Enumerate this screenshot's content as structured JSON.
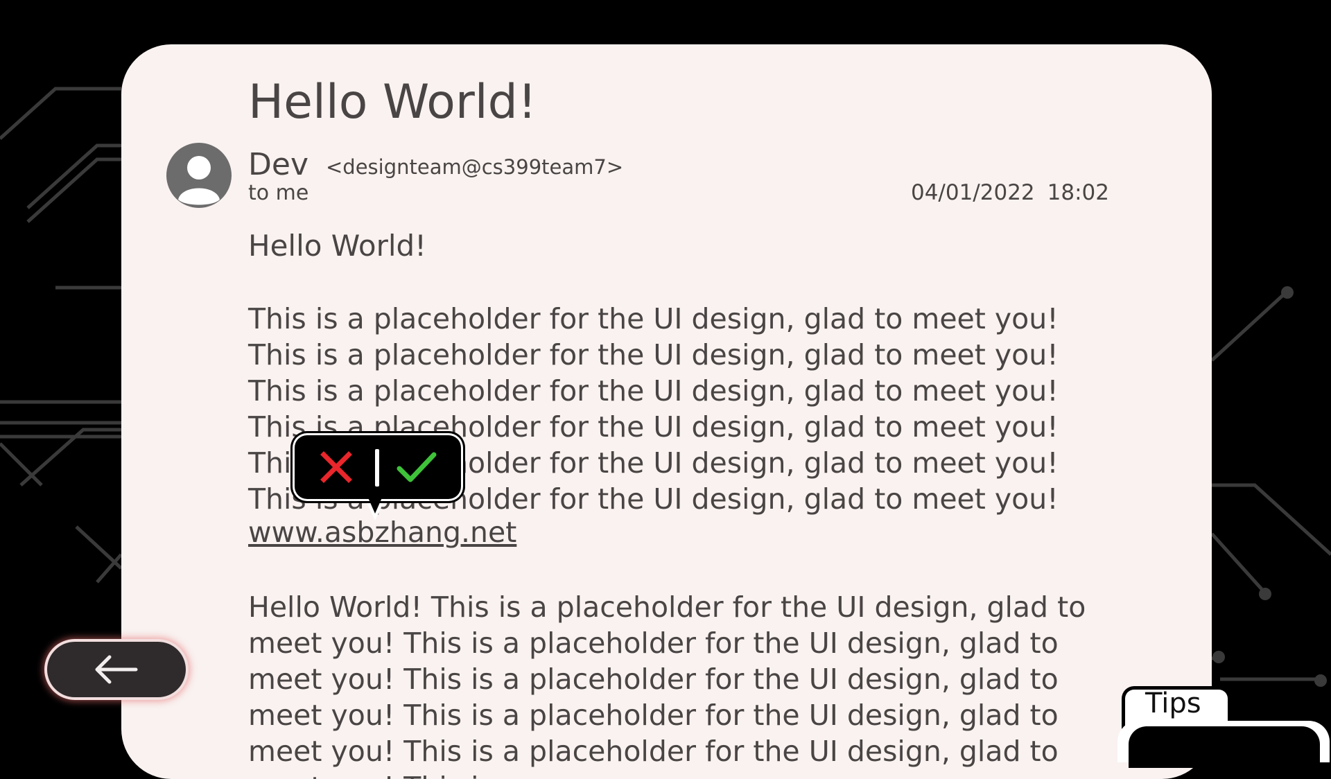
{
  "email": {
    "subject": "Hello World!",
    "sender_name": "Dev",
    "sender_email": "<designteam@cs399team7>",
    "recipient": "to me",
    "date": "04/01/2022",
    "time": "18:02",
    "greeting": "Hello World!",
    "paragraph1": "This is a placeholder for the UI design, glad to meet you! This is a placeholder for the UI design, glad to meet you! This is a placeholder for the UI design, glad to meet you! This is a placeholder for the UI design, glad to meet you! This is a placeholder for the UI design, glad to meet you! This is a placeholder for the UI design, glad to meet you!",
    "link": "www.asbzhang.net",
    "paragraph2": "Hello World! This is a placeholder for the UI design, glad to meet you! This is a placeholder for the UI design, glad to meet you! This is a placeholder for the UI design, glad to meet you! This is a placeholder for the UI design, glad to meet you! This is a placeholder for the UI design, glad to meet you! This is a"
  },
  "popup": {
    "reject_icon": "close-icon",
    "accept_icon": "check-icon",
    "reject_color": "#e8262b",
    "accept_color": "#3fc23a"
  },
  "navigation": {
    "back_icon": "arrow-left-icon"
  },
  "tips": {
    "label": "Tips"
  },
  "colors": {
    "background": "#000000",
    "card": "#f9f2f0",
    "text": "#4a4545",
    "back_button": "#2f2b2c"
  }
}
